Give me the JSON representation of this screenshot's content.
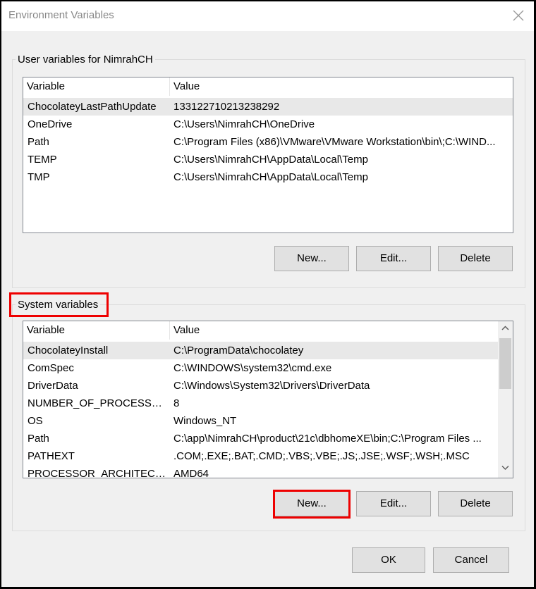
{
  "window": {
    "title": "Environment Variables",
    "close_glyph": "✕"
  },
  "user_vars": {
    "group_label": "User variables for NimrahCH",
    "columns": {
      "variable": "Variable",
      "value": "Value"
    },
    "rows": [
      {
        "variable": "ChocolateyLastPathUpdate",
        "value": "133122710213238292"
      },
      {
        "variable": "OneDrive",
        "value": "C:\\Users\\NimrahCH\\OneDrive"
      },
      {
        "variable": "Path",
        "value": "C:\\Program Files (x86)\\VMware\\VMware Workstation\\bin\\;C:\\WIND..."
      },
      {
        "variable": "TEMP",
        "value": "C:\\Users\\NimrahCH\\AppData\\Local\\Temp"
      },
      {
        "variable": "TMP",
        "value": "C:\\Users\\NimrahCH\\AppData\\Local\\Temp"
      }
    ],
    "buttons": {
      "new": "New...",
      "edit": "Edit...",
      "delete": "Delete"
    }
  },
  "system_vars": {
    "group_label": "System variables",
    "columns": {
      "variable": "Variable",
      "value": "Value"
    },
    "rows": [
      {
        "variable": "ChocolateyInstall",
        "value": "C:\\ProgramData\\chocolatey"
      },
      {
        "variable": "ComSpec",
        "value": "C:\\WINDOWS\\system32\\cmd.exe"
      },
      {
        "variable": "DriverData",
        "value": "C:\\Windows\\System32\\Drivers\\DriverData"
      },
      {
        "variable": "NUMBER_OF_PROCESSORS",
        "value": "8"
      },
      {
        "variable": "OS",
        "value": "Windows_NT"
      },
      {
        "variable": "Path",
        "value": "C:\\app\\NimrahCH\\product\\21c\\dbhomeXE\\bin;C:\\Program Files ..."
      },
      {
        "variable": "PATHEXT",
        "value": ".COM;.EXE;.BAT;.CMD;.VBS;.VBE;.JS;.JSE;.WSF;.WSH;.MSC"
      },
      {
        "variable": "PROCESSOR_ARCHITECTURE",
        "value": "AMD64"
      }
    ],
    "buttons": {
      "new": "New...",
      "edit": "Edit...",
      "delete": "Delete"
    }
  },
  "dialog_buttons": {
    "ok": "OK",
    "cancel": "Cancel"
  },
  "colors": {
    "highlight": "#e00000",
    "selected_row": "#e8e8e8"
  }
}
